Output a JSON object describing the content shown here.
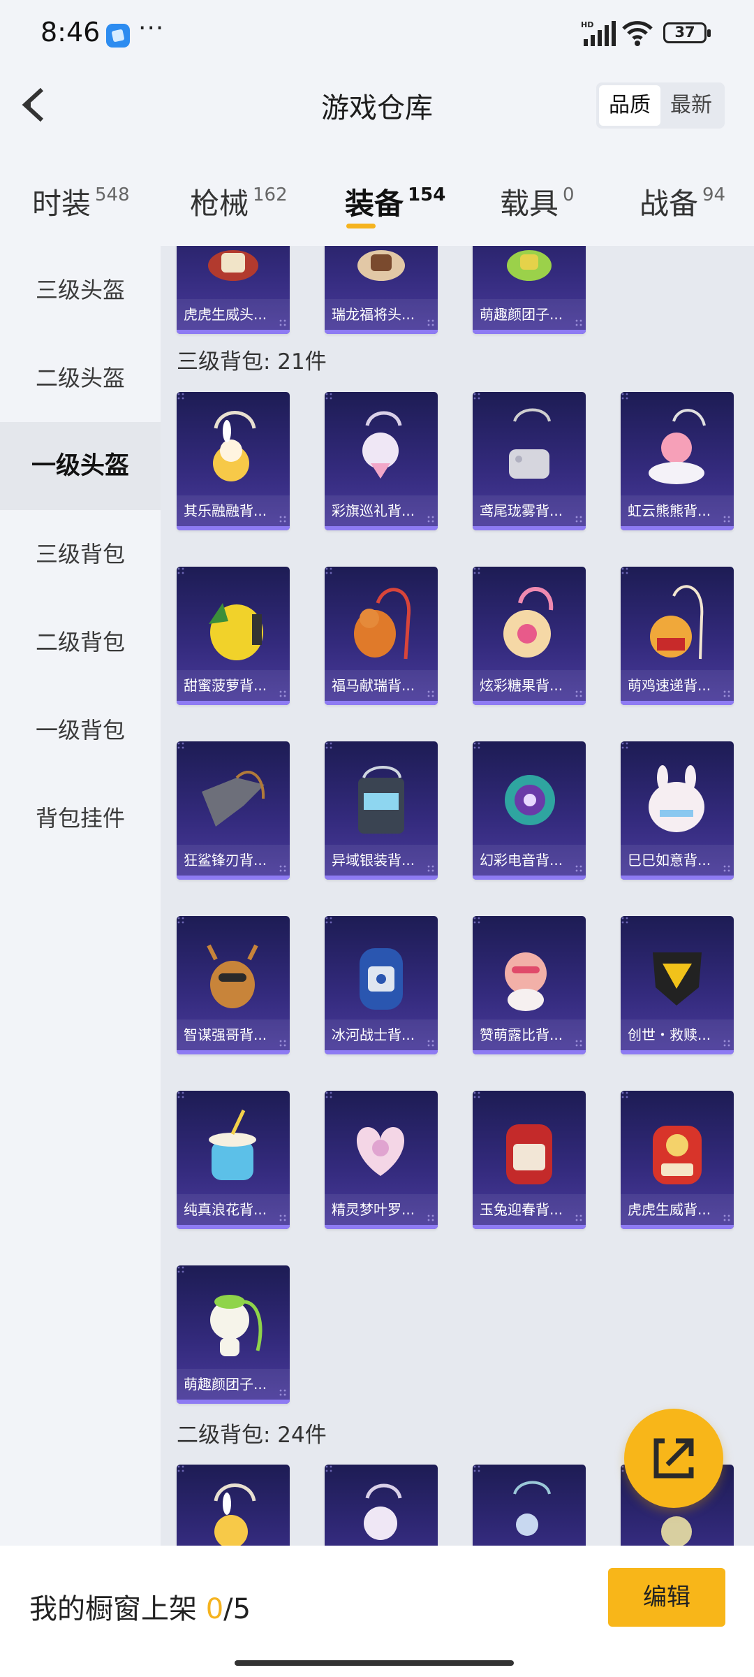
{
  "status": {
    "time": "8:46",
    "more": "···",
    "battery": "37",
    "hd": "HD"
  },
  "header": {
    "title": "游戏仓库",
    "sort_options": [
      "品质",
      "最新"
    ],
    "sort_selected": "品质"
  },
  "tabs": [
    {
      "label": "时装",
      "count": "548"
    },
    {
      "label": "枪械",
      "count": "162"
    },
    {
      "label": "装备",
      "count": "154",
      "active": true
    },
    {
      "label": "载具",
      "count": "0"
    },
    {
      "label": "战备",
      "count": "94"
    }
  ],
  "sidebar": {
    "items": [
      "三级头盔",
      "二级头盔",
      "一级头盔",
      "三级背包",
      "二级背包",
      "一级背包",
      "背包挂件"
    ],
    "active": "一级头盔"
  },
  "content": {
    "top_partial_items": [
      "虎虎生威头...",
      "瑞龙福将头...",
      "萌趣颜团子..."
    ],
    "section_3": {
      "title": "三级背包: 21件",
      "items": [
        "其乐融融背...",
        "彩旗巡礼背...",
        "鸢尾珑雾背...",
        "虹云熊熊背...",
        "甜蜜菠萝背...",
        "福马献瑞背...",
        "炫彩糖果背...",
        "萌鸡速递背...",
        "狂鲨锋刃背...",
        "异域银装背...",
        "幻彩电音背...",
        "巳巳如意背...",
        "智谋强哥背...",
        "冰河战士背...",
        "赞萌露比背...",
        "创世・救赎...",
        "纯真浪花背...",
        "精灵梦叶罗...",
        "玉兔迎春背...",
        "虎虎生威背...",
        "萌趣颜团子..."
      ]
    },
    "section_2": {
      "title": "二级背包: 24件"
    }
  },
  "bottom": {
    "showcase_label": "我的橱窗上架",
    "count": "0",
    "total": "/5",
    "edit": "编辑"
  },
  "colors": {
    "accent": "#f8b619",
    "card_bg": "#2c2670",
    "card_stripe": "#8e7bf3",
    "page_bg": "#f2f4f8"
  }
}
